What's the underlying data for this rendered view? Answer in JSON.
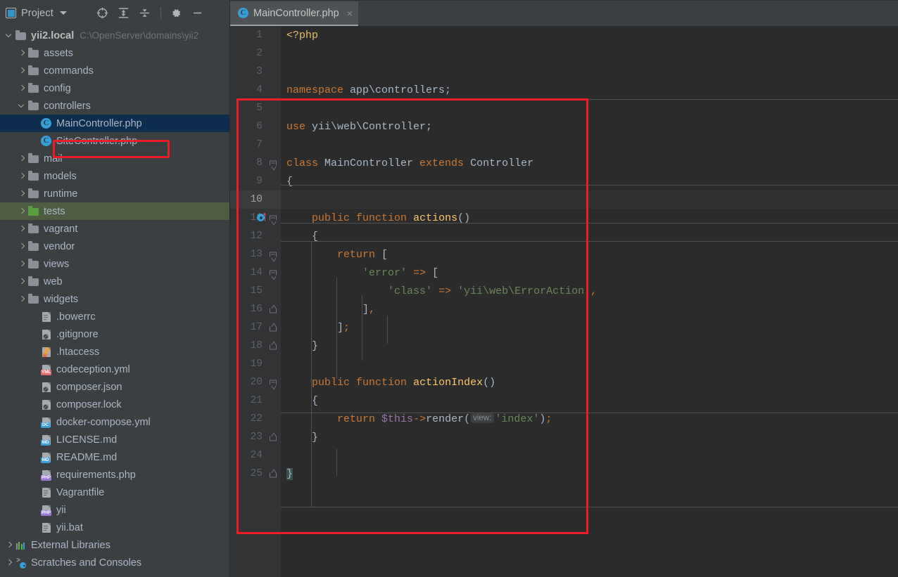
{
  "toolbar": {
    "project_label": "Project",
    "window_icon": "project-window-icon",
    "dropdown_icon": "chevron-down-icon",
    "buttons": [
      {
        "name": "locate-icon",
        "title": "Select Opened File"
      },
      {
        "name": "expand-all-icon",
        "title": "Expand All"
      },
      {
        "name": "collapse-all-icon",
        "title": "Collapse All"
      },
      {
        "name": "gear-icon",
        "title": "Settings"
      },
      {
        "name": "minimize-icon",
        "title": "Hide"
      }
    ]
  },
  "tabs": [
    {
      "label": "MainController.php",
      "icon": "php-class-icon",
      "close": "×",
      "active": true
    }
  ],
  "tree": [
    {
      "label": "yii2.local",
      "path": "C:\\OpenServer\\domains\\yii2",
      "icon": "folder",
      "arrow": "down",
      "indent": 0,
      "bold": true
    },
    {
      "label": "assets",
      "icon": "folder",
      "arrow": "right",
      "indent": 1
    },
    {
      "label": "commands",
      "icon": "folder",
      "arrow": "right",
      "indent": 1
    },
    {
      "label": "config",
      "icon": "folder",
      "arrow": "right",
      "indent": 1
    },
    {
      "label": "controllers",
      "icon": "folder",
      "arrow": "down",
      "indent": 1
    },
    {
      "label": "MainController.php",
      "icon": "php-class",
      "arrow": "none",
      "indent": 2,
      "selected": true
    },
    {
      "label": "SiteController.php",
      "icon": "php-class",
      "arrow": "none",
      "indent": 2
    },
    {
      "label": "mail",
      "icon": "folder",
      "arrow": "right",
      "indent": 1
    },
    {
      "label": "models",
      "icon": "folder",
      "arrow": "right",
      "indent": 1
    },
    {
      "label": "runtime",
      "icon": "folder",
      "arrow": "right",
      "indent": 1
    },
    {
      "label": "tests",
      "icon": "folder-green",
      "arrow": "right",
      "indent": 1,
      "highlight": true
    },
    {
      "label": "vagrant",
      "icon": "folder",
      "arrow": "right",
      "indent": 1
    },
    {
      "label": "vendor",
      "icon": "folder",
      "arrow": "right",
      "indent": 1
    },
    {
      "label": "views",
      "icon": "folder",
      "arrow": "right",
      "indent": 1
    },
    {
      "label": "web",
      "icon": "folder",
      "arrow": "right",
      "indent": 1
    },
    {
      "label": "widgets",
      "icon": "folder",
      "arrow": "right",
      "indent": 1
    },
    {
      "label": ".bowerrc",
      "icon": "file-plain",
      "arrow": "none",
      "indent": 2
    },
    {
      "label": ".gitignore",
      "icon": "file-git",
      "arrow": "none",
      "indent": 2
    },
    {
      "label": ".htaccess",
      "icon": "file-pencil",
      "arrow": "none",
      "indent": 2
    },
    {
      "label": "codeception.yml",
      "icon": "file-yml",
      "arrow": "none",
      "indent": 2
    },
    {
      "label": "composer.json",
      "icon": "file-composer",
      "arrow": "none",
      "indent": 2
    },
    {
      "label": "composer.lock",
      "icon": "file-composer",
      "arrow": "none",
      "indent": 2
    },
    {
      "label": "docker-compose.yml",
      "icon": "file-dc",
      "arrow": "none",
      "indent": 2
    },
    {
      "label": "LICENSE.md",
      "icon": "file-md",
      "arrow": "none",
      "indent": 2
    },
    {
      "label": "README.md",
      "icon": "file-md",
      "arrow": "none",
      "indent": 2
    },
    {
      "label": "requirements.php",
      "icon": "file-php",
      "arrow": "none",
      "indent": 2
    },
    {
      "label": "Vagrantfile",
      "icon": "file-plain",
      "arrow": "none",
      "indent": 2
    },
    {
      "label": "yii",
      "icon": "file-php",
      "arrow": "none",
      "indent": 2
    },
    {
      "label": "yii.bat",
      "icon": "file-plain",
      "arrow": "none",
      "indent": 2
    },
    {
      "label": "External Libraries",
      "icon": "libraries",
      "arrow": "right",
      "indent": 0
    },
    {
      "label": "Scratches and Consoles",
      "icon": "scratches",
      "arrow": "right",
      "indent": 0
    }
  ],
  "editor": {
    "current_line": 10,
    "gutter_icon_line": 11,
    "gutter_icon_name": "method-override-icon",
    "line_numbers": [
      1,
      2,
      3,
      4,
      5,
      6,
      7,
      8,
      9,
      10,
      11,
      12,
      13,
      14,
      15,
      16,
      17,
      18,
      19,
      20,
      21,
      22,
      23,
      24,
      25
    ],
    "fold_markers": {
      "8": "open",
      "11": "open",
      "13": "open",
      "14": "open",
      "16": "close",
      "17": "close",
      "18": "close",
      "20": "open",
      "23": "close",
      "25": "close"
    },
    "lines": [
      {
        "n": 1,
        "tokens": [
          {
            "t": "<?php",
            "c": "tagphp"
          }
        ]
      },
      {
        "n": 2,
        "tokens": []
      },
      {
        "n": 3,
        "tokens": []
      },
      {
        "n": 4,
        "tokens": [
          {
            "t": "namespace",
            "c": "kw"
          },
          {
            "t": " app\\controllers;",
            "c": "def"
          }
        ]
      },
      {
        "n": 5,
        "tokens": []
      },
      {
        "n": 6,
        "tokens": [
          {
            "t": "use",
            "c": "kw"
          },
          {
            "t": " yii\\web\\Controller;",
            "c": "def"
          }
        ]
      },
      {
        "n": 7,
        "tokens": []
      },
      {
        "n": 8,
        "tokens": [
          {
            "t": "class",
            "c": "kw"
          },
          {
            "t": " MainController ",
            "c": "cls"
          },
          {
            "t": "extends",
            "c": "kw"
          },
          {
            "t": " Controller",
            "c": "def"
          }
        ]
      },
      {
        "n": 9,
        "tokens": [
          {
            "t": "{",
            "c": "punc"
          }
        ]
      },
      {
        "n": 10,
        "tokens": []
      },
      {
        "n": 11,
        "tokens": [
          {
            "t": "    ",
            "c": "def"
          },
          {
            "t": "public function",
            "c": "kw"
          },
          {
            "t": " ",
            "c": "def"
          },
          {
            "t": "actions",
            "c": "fn"
          },
          {
            "t": "()",
            "c": "punc"
          }
        ]
      },
      {
        "n": 12,
        "tokens": [
          {
            "t": "    {",
            "c": "punc"
          }
        ]
      },
      {
        "n": 13,
        "tokens": [
          {
            "t": "        ",
            "c": "def"
          },
          {
            "t": "return",
            "c": "kw"
          },
          {
            "t": " [",
            "c": "punc"
          }
        ]
      },
      {
        "n": 14,
        "tokens": [
          {
            "t": "            ",
            "c": "def"
          },
          {
            "t": "'error'",
            "c": "str"
          },
          {
            "t": " ",
            "c": "def"
          },
          {
            "t": "=>",
            "c": "kw"
          },
          {
            "t": " [",
            "c": "punc"
          }
        ]
      },
      {
        "n": 15,
        "tokens": [
          {
            "t": "                ",
            "c": "def"
          },
          {
            "t": "'class'",
            "c": "str"
          },
          {
            "t": " ",
            "c": "def"
          },
          {
            "t": "=>",
            "c": "kw"
          },
          {
            "t": " ",
            "c": "def"
          },
          {
            "t": "'yii\\web\\ErrorAction'",
            "c": "str"
          },
          {
            "t": ",",
            "c": "kw"
          }
        ]
      },
      {
        "n": 16,
        "tokens": [
          {
            "t": "            ]",
            "c": "punc"
          },
          {
            "t": ",",
            "c": "kw"
          }
        ]
      },
      {
        "n": 17,
        "tokens": [
          {
            "t": "        ]",
            "c": "punc"
          },
          {
            "t": ";",
            "c": "kw"
          }
        ]
      },
      {
        "n": 18,
        "tokens": [
          {
            "t": "    }",
            "c": "punc"
          }
        ]
      },
      {
        "n": 19,
        "tokens": []
      },
      {
        "n": 20,
        "tokens": [
          {
            "t": "    ",
            "c": "def"
          },
          {
            "t": "public function",
            "c": "kw"
          },
          {
            "t": " ",
            "c": "def"
          },
          {
            "t": "actionIndex",
            "c": "fn"
          },
          {
            "t": "()",
            "c": "punc"
          }
        ]
      },
      {
        "n": 21,
        "tokens": [
          {
            "t": "    {",
            "c": "punc"
          }
        ]
      },
      {
        "n": 22,
        "tokens": [
          {
            "t": "        ",
            "c": "def"
          },
          {
            "t": "return",
            "c": "kw"
          },
          {
            "t": " ",
            "c": "def"
          },
          {
            "t": "$this",
            "c": "var"
          },
          {
            "t": "->",
            "c": "kw"
          },
          {
            "t": "render",
            "c": "def"
          },
          {
            "t": "(",
            "c": "punc"
          },
          {
            "t": "view:",
            "c": "hint"
          },
          {
            "t": "'index'",
            "c": "str"
          },
          {
            "t": ")",
            "c": "punc"
          },
          {
            "t": ";",
            "c": "kw"
          }
        ]
      },
      {
        "n": 23,
        "tokens": [
          {
            "t": "    }",
            "c": "punc"
          }
        ]
      },
      {
        "n": 24,
        "tokens": []
      },
      {
        "n": 25,
        "tokens": [
          {
            "t": "}",
            "c": "punc",
            "hl": true
          }
        ]
      }
    ]
  },
  "annotations": {
    "sidebar_box": {
      "label": "red-highlight-main-controller"
    },
    "code_box": {
      "label": "red-highlight-class-body"
    }
  },
  "colors": {
    "accent_red": "#ee1c25",
    "selection_blue": "#0d2d4f",
    "highlight_green": "#4e5c41",
    "keyword_orange": "#cc7832",
    "string_green": "#6a8759",
    "method_yellow": "#ffc66d",
    "variable_purple": "#9876aa",
    "editor_bg": "#2b2b2b",
    "panel_bg": "#3c3f41"
  }
}
